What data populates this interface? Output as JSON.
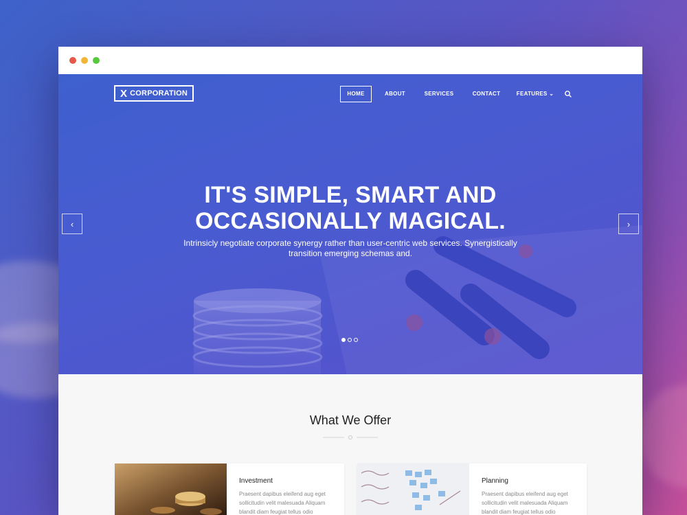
{
  "brand": {
    "logo_mark": "X",
    "logo_text": "CORPORATION"
  },
  "nav": {
    "items": [
      {
        "label": "HOME",
        "active": true
      },
      {
        "label": "ABOUT",
        "active": false
      },
      {
        "label": "SERVICES",
        "active": false
      },
      {
        "label": "CONTACT",
        "active": false
      },
      {
        "label": "FEATURES",
        "active": false
      }
    ],
    "features_chevron": "⌄"
  },
  "hero": {
    "headline_line1": "IT'S SIMPLE, SMART AND",
    "headline_line2": "OCCASIONALLY MAGICAL.",
    "subtext_line1": "Intrinsicly negotiate corporate synergy rather than user-centric web services. Synergistically",
    "subtext_line2": "transition emerging schemas and.",
    "prev_icon": "‹",
    "next_icon": "›",
    "slides_total": 3,
    "active_slide": 1
  },
  "offer": {
    "title": "What We Offer",
    "cards": [
      {
        "title": "Investment",
        "text": "Praesent dapibus eleifend aug eget sollicitudin velit malesuada Aliquam blandit diam feugiat tellus odio"
      },
      {
        "title": "Planning",
        "text": "Praesent dapibus eleifend aug eget sollicitudin velit malesuada Aliquam blandit diam feugiat tellus odio"
      }
    ]
  },
  "colors": {
    "dot_red": "#e5584a",
    "dot_yellow": "#f2b53a",
    "dot_green": "#58c83f",
    "hero_blue": "#3a63cf",
    "hero_violet": "#5b4fcb"
  }
}
